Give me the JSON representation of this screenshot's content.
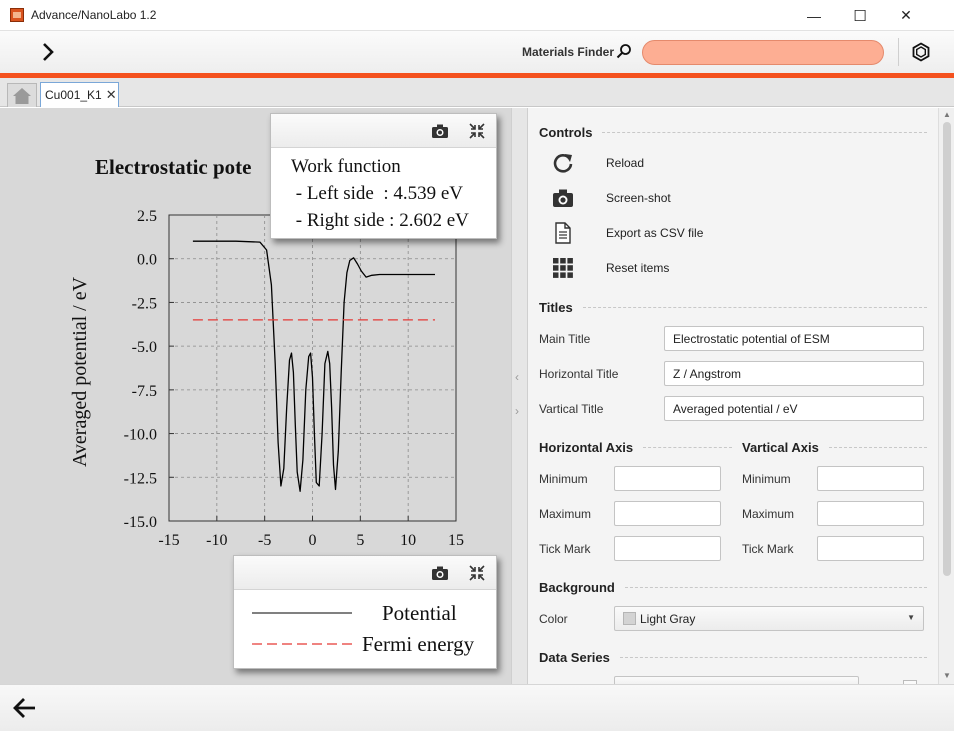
{
  "window": {
    "title": "Advance/NanoLabo 1.2",
    "minimize": "—",
    "maximize": "☐",
    "close": "✕"
  },
  "toolbar": {
    "finder_label": "Materials Finder",
    "search_value": "",
    "search_placeholder": ""
  },
  "tabs": [
    {
      "label": "Cu001_K1",
      "close": "✕"
    }
  ],
  "chart": {
    "title_visible": "Electrostatic pote",
    "work_function": {
      "heading": "Work function",
      "left": " - Left side  : 4.539 eV",
      "right": " - Right side : 2.602 eV"
    },
    "legend": [
      {
        "label": "Potential",
        "color": "#000000",
        "style": "solid"
      },
      {
        "label": "Fermi energy",
        "color": "#e53935",
        "style": "dashed"
      }
    ]
  },
  "chart_data": {
    "type": "line",
    "title": "Electrostatic potential of ESM",
    "xlabel": "",
    "ylabel": "Averaged potential / eV",
    "xlim": [
      -15,
      15
    ],
    "ylim": [
      -15.0,
      2.5
    ],
    "xticks": [
      -15,
      -10,
      -5,
      0,
      5,
      10,
      15
    ],
    "yticks": [
      "2.5",
      "0.0",
      "-2.5",
      "-5.0",
      "-7.5",
      "-10.0",
      "-12.5",
      "-15.0"
    ],
    "grid": true,
    "series": [
      {
        "name": "Potential",
        "color": "#000000",
        "dash": "solid",
        "x": [
          -12.5,
          -8,
          -5.5,
          -4.8,
          -4.3,
          -3.9,
          -3.6,
          -3.3,
          -3.0,
          -2.7,
          -2.4,
          -2.2,
          -2.0,
          -1.8,
          -1.6,
          -1.3,
          -1.0,
          -0.7,
          -0.4,
          -0.2,
          0.0,
          0.2,
          0.4,
          0.7,
          1.0,
          1.3,
          1.6,
          1.8,
          2.0,
          2.2,
          2.4,
          2.7,
          3.0,
          3.3,
          3.6,
          3.9,
          4.3,
          4.7,
          5.1,
          5.6,
          6.2,
          7.0,
          8.0,
          10.0,
          12.8
        ],
        "y": [
          1.0,
          1.0,
          0.95,
          0.5,
          -1.5,
          -6.0,
          -10.5,
          -13.0,
          -12.0,
          -8.5,
          -5.8,
          -5.4,
          -6.5,
          -9.5,
          -12.2,
          -13.3,
          -11.5,
          -7.5,
          -5.6,
          -5.4,
          -6.8,
          -10.0,
          -12.8,
          -13.0,
          -10.0,
          -6.0,
          -5.3,
          -6.0,
          -8.5,
          -11.8,
          -13.2,
          -11.0,
          -6.5,
          -2.5,
          -0.8,
          -0.1,
          0.05,
          -0.3,
          -0.7,
          -1.05,
          -0.95,
          -0.9,
          -0.9,
          -0.9,
          -0.9
        ]
      },
      {
        "name": "Fermi energy",
        "color": "#e53935",
        "dash": "dashed",
        "x": [
          -12.5,
          12.8
        ],
        "y": [
          -3.5,
          -3.5
        ]
      }
    ]
  },
  "controls": {
    "heading": "Controls",
    "items": [
      {
        "label": "Reload"
      },
      {
        "label": "Screen-shot"
      },
      {
        "label": "Export as CSV file"
      },
      {
        "label": "Reset items"
      }
    ]
  },
  "titles": {
    "heading": "Titles",
    "main_label": "Main Title",
    "main_value": "Electrostatic potential of ESM",
    "horizontal_label": "Horizontal Title",
    "horizontal_value": "Z / Angstrom",
    "vertical_label": "Vartical Title",
    "vertical_value": "Averaged potential / eV"
  },
  "horizontal_axis": {
    "heading": "Horizontal Axis",
    "min_label": "Minimum",
    "max_label": "Maximum",
    "tick_label": "Tick Mark",
    "min": "",
    "max": "",
    "tick": ""
  },
  "vertical_axis": {
    "heading": "Vartical Axis",
    "min_label": "Minimum",
    "max_label": "Maximum",
    "tick_label": "Tick Mark",
    "min": "",
    "max": "",
    "tick": ""
  },
  "background": {
    "heading": "Background",
    "color_label": "Color",
    "color_value": "Light Gray"
  },
  "data_series": {
    "heading": "Data Series"
  }
}
